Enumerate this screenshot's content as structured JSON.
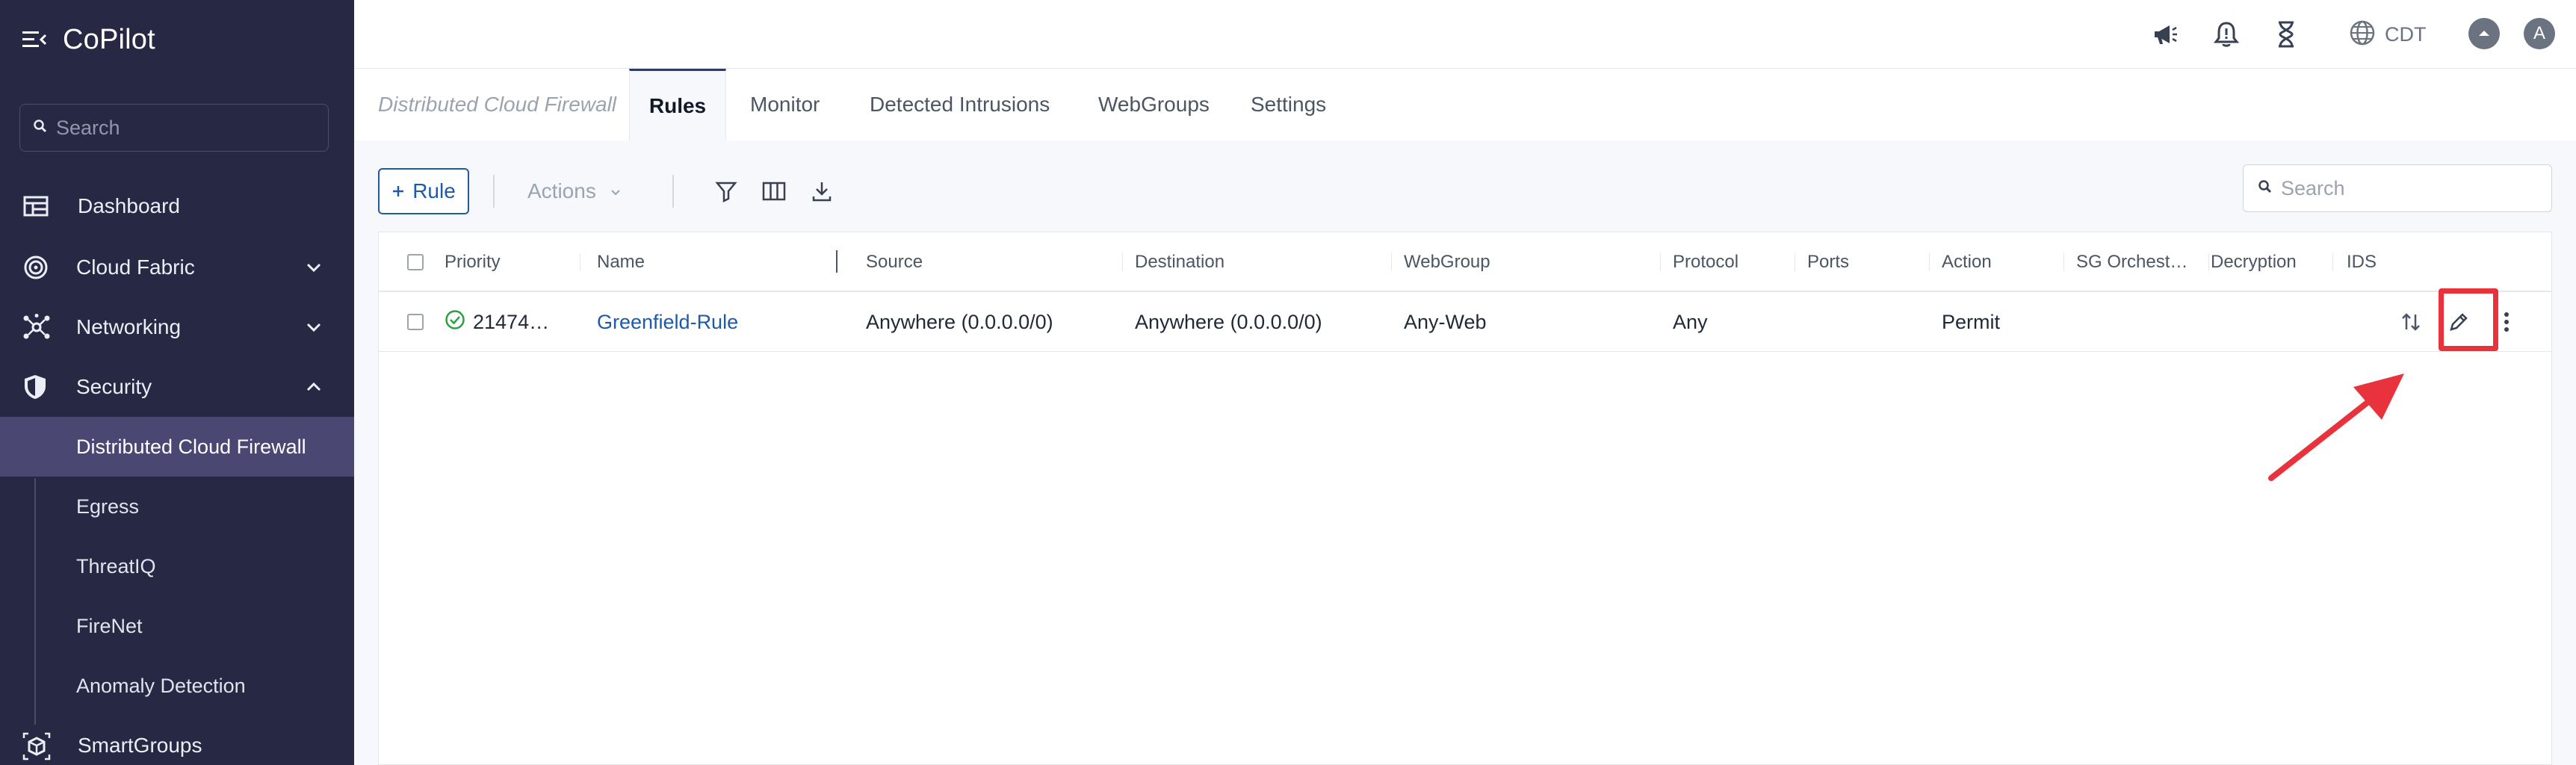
{
  "app": {
    "title": "CoPilot"
  },
  "sidebar": {
    "search_placeholder": "Search",
    "items": [
      {
        "label": "Dashboard",
        "icon": "dashboard-icon"
      },
      {
        "label": "Cloud Fabric",
        "icon": "cloud-fabric-icon",
        "expanded": false
      },
      {
        "label": "Networking",
        "icon": "networking-icon",
        "expanded": false
      },
      {
        "label": "Security",
        "icon": "shield-icon",
        "expanded": true
      },
      {
        "label": "SmartGroups",
        "icon": "smartgroups-icon"
      }
    ],
    "security_children": [
      {
        "label": "Distributed Cloud Firewall",
        "active": true
      },
      {
        "label": "Egress"
      },
      {
        "label": "ThreatIQ"
      },
      {
        "label": "FireNet"
      },
      {
        "label": "Anomaly Detection"
      }
    ]
  },
  "topbar": {
    "timezone": "CDT",
    "avatar_letter": "A",
    "icons": [
      "megaphone-icon",
      "bell-icon",
      "hourglass-icon",
      "globe-icon",
      "chevron-up-icon"
    ]
  },
  "tabs": {
    "breadcrumb": "Distributed Cloud Firewall",
    "items": [
      {
        "label": "Rules",
        "active": true
      },
      {
        "label": "Monitor"
      },
      {
        "label": "Detected Intrusions"
      },
      {
        "label": "WebGroups"
      },
      {
        "label": "Settings"
      }
    ]
  },
  "toolbar": {
    "add_rule_label": "Rule",
    "actions_label": "Actions",
    "search_placeholder": "Search"
  },
  "table": {
    "columns": [
      "Priority",
      "Name",
      "Source",
      "Destination",
      "WebGroup",
      "Protocol",
      "Ports",
      "Action",
      "SG Orchest…",
      "Decryption",
      "IDS"
    ],
    "rows": [
      {
        "priority": "21474…",
        "name": "Greenfield-Rule",
        "source": "Anywhere (0.0.0.0/0)",
        "destination": "Anywhere (0.0.0.0/0)",
        "webgroup": "Any-Web",
        "protocol": "Any",
        "ports": "",
        "action": "Permit",
        "sg_orchestration": "",
        "decryption": "",
        "ids": ""
      }
    ]
  },
  "colors": {
    "sidebar_bg": "#262844",
    "sidebar_active": "#4a4872",
    "link": "#1f5aa6",
    "success": "#2f9e44",
    "highlight": "#e8323c"
  }
}
